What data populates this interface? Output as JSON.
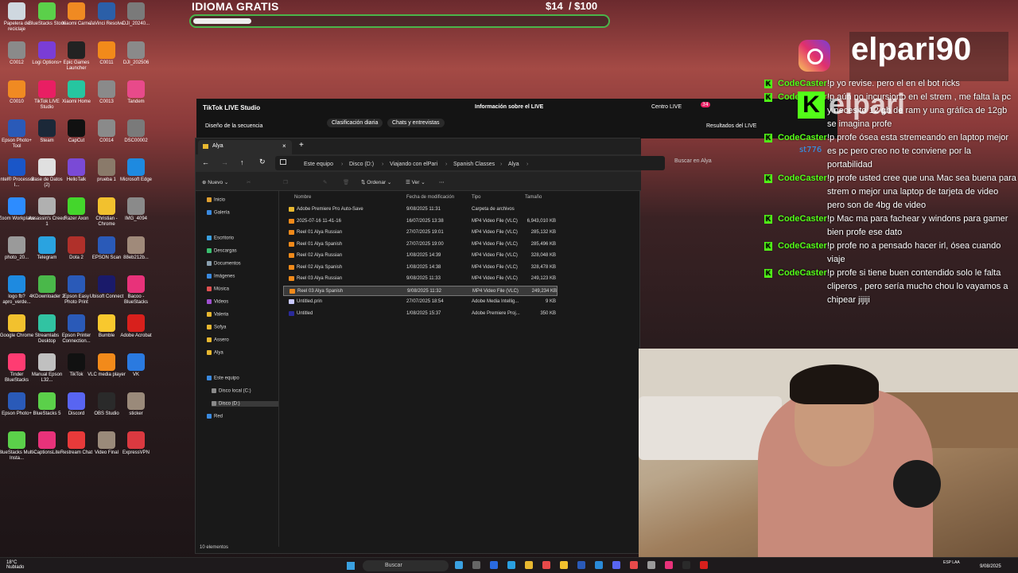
{
  "goal": {
    "title": "IDIOMA GRATIS",
    "amount": "$14",
    "target": "/ $100",
    "progress_fraction": 0.14
  },
  "brand": {
    "name": "elpari90",
    "icon": "instagram-icon",
    "kick_word": "elpari"
  },
  "desktop_icons": [
    {
      "label": "Papelera de reciclaje",
      "color": "#cfd8e0"
    },
    {
      "label": "BlueStacks Store",
      "color": "#5bd04a"
    },
    {
      "label": "Xiaomi Carne",
      "color": "#f08a22"
    },
    {
      "label": "JaVinci Resolve",
      "color": "#2b5fa8"
    },
    {
      "label": "DJI_20240...",
      "color": "#7a7a7a"
    },
    {
      "label": "C0012",
      "color": "#8a8a8a"
    },
    {
      "label": "Logi Options+",
      "color": "#7a3dd6"
    },
    {
      "label": "Epic Games Launcher",
      "color": "#222222"
    },
    {
      "label": "C0011",
      "color": "#f28a1a"
    },
    {
      "label": "DJI_202506",
      "color": "#8a8a8a"
    },
    {
      "label": "C0010",
      "color": "#f08a22"
    },
    {
      "label": "TikTok LIVE Studio",
      "color": "#e91e63"
    },
    {
      "label": "Xiaomi Home",
      "color": "#26c6a0"
    },
    {
      "label": "C0013",
      "color": "#8a8a8a"
    },
    {
      "label": "Tandem",
      "color": "#e84a8a"
    },
    {
      "label": "Epson Photo+ Tool",
      "color": "#2a5ab8"
    },
    {
      "label": "Steam",
      "color": "#1b2838"
    },
    {
      "label": "CapCut",
      "color": "#111111"
    },
    {
      "label": "C0014",
      "color": "#8a8a8a"
    },
    {
      "label": "DSC00002",
      "color": "#7a7a7a"
    },
    {
      "label": "Intel® Processor I...",
      "color": "#1a56c8"
    },
    {
      "label": "Base de Datos (2)",
      "color": "#e0e0e0"
    },
    {
      "label": "HelloTalk",
      "color": "#7a4ad6"
    },
    {
      "label": "prueba 1",
      "color": "#8a7a6a"
    },
    {
      "label": "Microsoft Edge",
      "color": "#1e8ae0"
    },
    {
      "label": "Zoom Workplace",
      "color": "#2d8cff"
    },
    {
      "label": "Assassin's Creed 1",
      "color": "#b0b0b0"
    },
    {
      "label": "Razer Axon",
      "color": "#44d62c"
    },
    {
      "label": "Christian - Chrome",
      "color": "#f2c12e"
    },
    {
      "label": "IMG_4094",
      "color": "#8a8a8a"
    },
    {
      "label": "photo_20...",
      "color": "#9a9a9a"
    },
    {
      "label": "Telegram",
      "color": "#2aa3e0"
    },
    {
      "label": "Dota 2",
      "color": "#b0302a"
    },
    {
      "label": "EPSON Scan",
      "color": "#2a5ab8"
    },
    {
      "label": "88eb212b...",
      "color": "#a08a7a"
    },
    {
      "label": "logo fb? apro_verde...",
      "color": "#1e8ae0"
    },
    {
      "label": "4KDownloader 2",
      "color": "#4ab84a"
    },
    {
      "label": "Epson Easy Photo Print",
      "color": "#2a5ab8"
    },
    {
      "label": "Ubisoft Connect",
      "color": "#1a1a6a"
    },
    {
      "label": "Bacoo - BlueStacks",
      "color": "#e8327a"
    },
    {
      "label": "Google Chrome",
      "color": "#f2c12e"
    },
    {
      "label": "Streamlabs Desktop",
      "color": "#31c3a2"
    },
    {
      "label": "Epson Printer Connection...",
      "color": "#2a5ab8"
    },
    {
      "label": "Bumble",
      "color": "#f8c82e"
    },
    {
      "label": "Adobe Acrobat",
      "color": "#d8201c"
    },
    {
      "label": "Tinder BlueStacks",
      "color": "#fe3c72"
    },
    {
      "label": "Manual Epson L32...",
      "color": "#c0c0c0"
    },
    {
      "label": "TikTok",
      "color": "#111111"
    },
    {
      "label": "VLC media player",
      "color": "#f28a1a"
    },
    {
      "label": "VK",
      "color": "#2a7ae0"
    },
    {
      "label": "Epson Photo+",
      "color": "#2a5ab8"
    },
    {
      "label": "BlueStacks 5",
      "color": "#5bd04a"
    },
    {
      "label": "Discord",
      "color": "#5865f2"
    },
    {
      "label": "OBS Studio",
      "color": "#2a2a2a"
    },
    {
      "label": "sticker",
      "color": "#9a8a7a"
    },
    {
      "label": "BlueStacks Multi-Insta...",
      "color": "#5bd04a"
    },
    {
      "label": "CaptionsLite",
      "color": "#e8327a"
    },
    {
      "label": "Restream Chat",
      "color": "#e83a3a"
    },
    {
      "label": "Video Final",
      "color": "#9a8a7a"
    },
    {
      "label": "ExpressVPN",
      "color": "#da3940"
    }
  ],
  "chat": [
    {
      "user": "CodeCaster",
      "text": "!p yo revise. pero el en el bot ricks"
    },
    {
      "user": "CodeCaster",
      "text": "!p aún no incursiono en el strem , me falta la pc y necesito 12 gb de ram y una gráfica de 12gb se imagina profe"
    },
    {
      "user": "CodeCaster",
      "text": "!p profe ósea esta stremeando en laptop mejor es pc pero creo no te conviene por la portabilidad"
    },
    {
      "user": "CodeCaster",
      "text": "!p profe usted cree que una Mac sea buena para strem o mejor una laptop de tarjeta de video pero son de 4bg de video"
    },
    {
      "user": "CodeCaster",
      "text": "!p Mac ma para fachear y windons para gamer bien profe ese dato"
    },
    {
      "user": "CodeCaster",
      "text": "!p profe no a pensado hacer irl, ósea cuando viaje"
    },
    {
      "user": "CodeCaster",
      "text": "!p profe si tiene buen contendido solo le falta cliperos , pero sería mucho chou lo vayamos a chipear jijiji"
    }
  ],
  "chat_extra_user": "st776",
  "tiktok": {
    "title": "TikTok LIVE Studio",
    "center": "Información sobre el LIVE",
    "right_link": "Centro LIVE",
    "badge": "34",
    "sub_title": "Diseño de la secuencia",
    "tabs": [
      "Clasificación diaria",
      "Chats y entrevistas"
    ],
    "results": "Resultados del LIVE"
  },
  "explorer": {
    "tab_title": "Alya",
    "breadcrumbs": [
      "Este equipo",
      "Disco (D:)",
      "Viajando con elPari",
      "Spanish Classes",
      "Alya"
    ],
    "search_placeholder": "Buscar en Alya",
    "toolbar": {
      "new": "Nuevo",
      "sort": "Ordenar",
      "view": "Ver"
    },
    "nav": [
      {
        "label": "Inicio",
        "color": "#e0a030"
      },
      {
        "label": "Galería",
        "color": "#3a8ae0"
      },
      {
        "label": "Escritorio",
        "color": "#3aa0e0"
      },
      {
        "label": "Descargas",
        "color": "#3ac070"
      },
      {
        "label": "Documentos",
        "color": "#8aa0b0"
      },
      {
        "label": "Imágenes",
        "color": "#3a8ae0"
      },
      {
        "label": "Música",
        "color": "#e05050"
      },
      {
        "label": "Videos",
        "color": "#a050d0"
      },
      {
        "label": "Valeria",
        "color": "#e8b830"
      },
      {
        "label": "Sofya",
        "color": "#e8b830"
      },
      {
        "label": "Assero",
        "color": "#e8b830"
      },
      {
        "label": "Alya",
        "color": "#e8b830"
      },
      {
        "label": "Este equipo",
        "color": "#3a8ae0"
      },
      {
        "label": "Disco local (C:)",
        "color": "#8a8a8a"
      },
      {
        "label": "Disco (D:)",
        "color": "#8a8a8a"
      },
      {
        "label": "Red",
        "color": "#3a8ae0"
      }
    ],
    "columns": [
      "Nombre",
      "Fecha de modificación",
      "Tipo",
      "Tamaño"
    ],
    "rows": [
      {
        "name": "Adobe Premiere Pro Auto-Save",
        "date": "9/08/2025 11:31",
        "type": "Carpeta de archivos",
        "size": "",
        "color": "#e8b830"
      },
      {
        "name": "2025-07-16 11-41-16",
        "date": "16/07/2025 13:38",
        "type": "MP4 Video File (VLC)",
        "size": "6,943,010 KB",
        "color": "#f28a1a"
      },
      {
        "name": "Reel 01 Alya Russian",
        "date": "27/07/2025 19:01",
        "type": "MP4 Video File (VLC)",
        "size": "285,132 KB",
        "color": "#f28a1a"
      },
      {
        "name": "Reel 01 Alya Spanish",
        "date": "27/07/2025 19:00",
        "type": "MP4 Video File (VLC)",
        "size": "285,496 KB",
        "color": "#f28a1a"
      },
      {
        "name": "Reel 02 Alya Russian",
        "date": "1/08/2025 14:39",
        "type": "MP4 Video File (VLC)",
        "size": "328,048 KB",
        "color": "#f28a1a"
      },
      {
        "name": "Reel 02 Alya Spanish",
        "date": "1/08/2025 14:38",
        "type": "MP4 Video File (VLC)",
        "size": "328,478 KB",
        "color": "#f28a1a"
      },
      {
        "name": "Reel 03 Alya Russian",
        "date": "9/08/2025 11:33",
        "type": "MP4 Video File (VLC)",
        "size": "249,123 KB",
        "color": "#f28a1a"
      },
      {
        "name": "Reel 03 Alya Spanish",
        "date": "9/08/2025 11:32",
        "type": "MP4 Video File (VLC)",
        "size": "249,234 KB",
        "color": "#f28a1a"
      },
      {
        "name": "Untitled.prin",
        "date": "27/07/2025 18:54",
        "type": "Adobe Media Intellig...",
        "size": "9 KB",
        "color": "#c8c8ff"
      },
      {
        "name": "Untitled",
        "date": "1/08/2025 15:37",
        "type": "Adobe Premiere Proj...",
        "size": "350 KB",
        "color": "#2a2a9a"
      }
    ],
    "status": "10 elementos"
  },
  "taskbar": {
    "search": "Buscar",
    "weather_temp": "18°C",
    "weather_desc": "Nublado",
    "lang": "ESP LAA",
    "date": "9/08/2025",
    "icons": [
      "#3aa0e0",
      "#666666",
      "#2a6ae0",
      "#2aa0e0",
      "#e8b830",
      "#e84a4a",
      "#f2c12e",
      "#2a5ab8",
      "#2a8ad8",
      "#5865f2",
      "#e84a4a",
      "#9a9a9a",
      "#e8327a",
      "#2a2a2a",
      "#d8201c"
    ]
  }
}
